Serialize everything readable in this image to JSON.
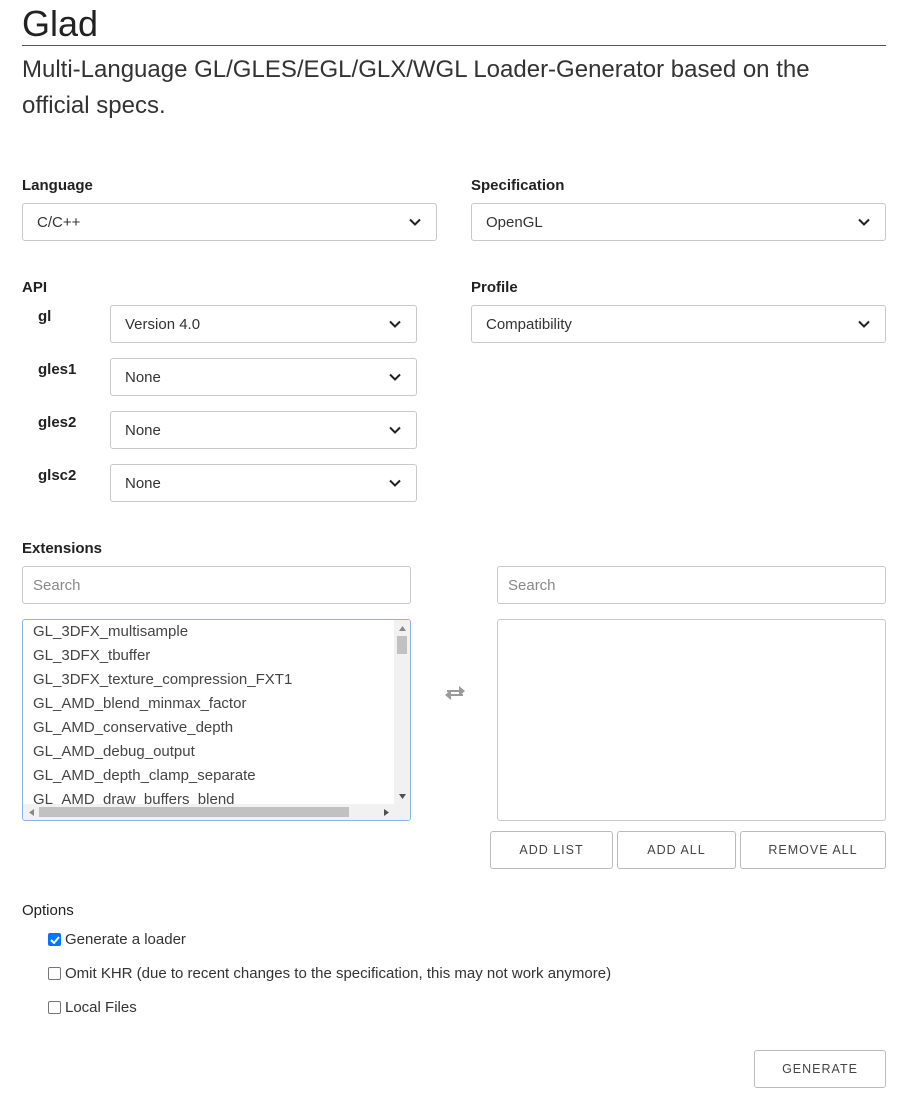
{
  "header": {
    "title": "Glad",
    "subtitle": "Multi-Language GL/GLES/EGL/GLX/WGL Loader-Generator based on the official specs."
  },
  "language": {
    "label": "Language",
    "selected": "C/C++"
  },
  "specification": {
    "label": "Specification",
    "selected": "OpenGL"
  },
  "api": {
    "label": "API",
    "rows": [
      {
        "name": "gl",
        "selected": "Version 4.0"
      },
      {
        "name": "gles1",
        "selected": "None"
      },
      {
        "name": "gles2",
        "selected": "None"
      },
      {
        "name": "glsc2",
        "selected": "None"
      }
    ]
  },
  "profile": {
    "label": "Profile",
    "selected": "Compatibility"
  },
  "extensions": {
    "label": "Extensions",
    "search_left_placeholder": "Search",
    "search_right_placeholder": "Search",
    "available": [
      "GL_3DFX_multisample",
      "GL_3DFX_tbuffer",
      "GL_3DFX_texture_compression_FXT1",
      "GL_AMD_blend_minmax_factor",
      "GL_AMD_conservative_depth",
      "GL_AMD_debug_output",
      "GL_AMD_depth_clamp_separate",
      "GL_AMD_draw_buffers_blend"
    ],
    "buttons": {
      "add_list": "ADD LIST",
      "add_all": "ADD ALL",
      "remove_all": "REMOVE ALL"
    },
    "icons": {
      "swap": "swap-arrows-icon"
    }
  },
  "options": {
    "label": "Options",
    "items": [
      {
        "label": "Generate a loader",
        "checked": true
      },
      {
        "label": "Omit KHR (due to recent changes to the specification, this may not work anymore)",
        "checked": false
      },
      {
        "label": "Local Files",
        "checked": false
      }
    ]
  },
  "generate": {
    "label": "GENERATE"
  },
  "colors": {
    "accent": "#0075ff",
    "listbox_border": "#8ab4e8"
  }
}
